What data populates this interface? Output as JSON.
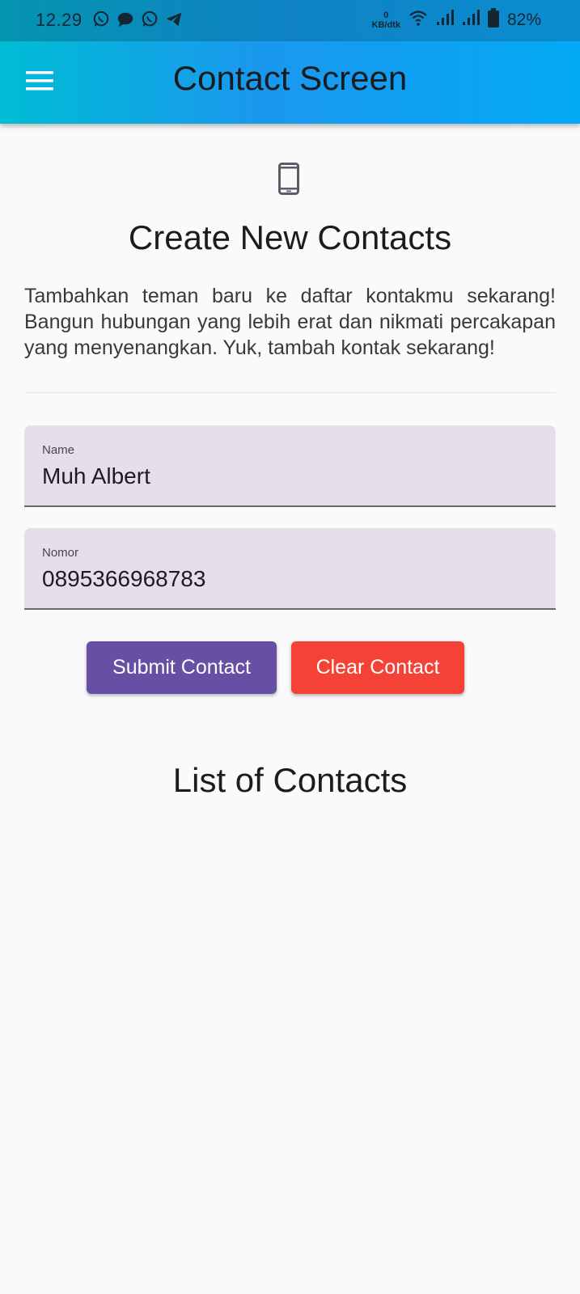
{
  "status_bar": {
    "time": "12.29",
    "net_speed_value": "0",
    "net_speed_unit": "KB/dtk",
    "battery": "82%",
    "icons": [
      "whatsapp-icon",
      "message-icon",
      "whatsapp-icon",
      "telegram-icon",
      "wifi-icon",
      "signal-icon",
      "signal-icon",
      "battery-icon"
    ]
  },
  "app_bar": {
    "title": "Contact Screen",
    "menu_icon": "hamburger-menu-icon"
  },
  "header": {
    "icon": "smartphone-icon",
    "title": "Create New Contacts",
    "description": "Tambahkan teman baru ke daftar kontakmu sekarang! Bangun hubungan yang lebih erat dan nikmati percakapan yang menyenangkan. Yuk, tambah kontak sekarang!"
  },
  "form": {
    "name": {
      "label": "Name",
      "value": "Muh Albert"
    },
    "nomor": {
      "label": "Nomor",
      "value": "0895366968783"
    }
  },
  "buttons": {
    "submit_label": "Submit Contact",
    "clear_label": "Clear Contact"
  },
  "list": {
    "title": "List of Contacts"
  },
  "colors": {
    "app_bar_start": "#00bcd4",
    "app_bar_end": "#03a9f4",
    "submit": "#6750a4",
    "clear": "#f44336",
    "field_fill": "#e6deeb"
  }
}
